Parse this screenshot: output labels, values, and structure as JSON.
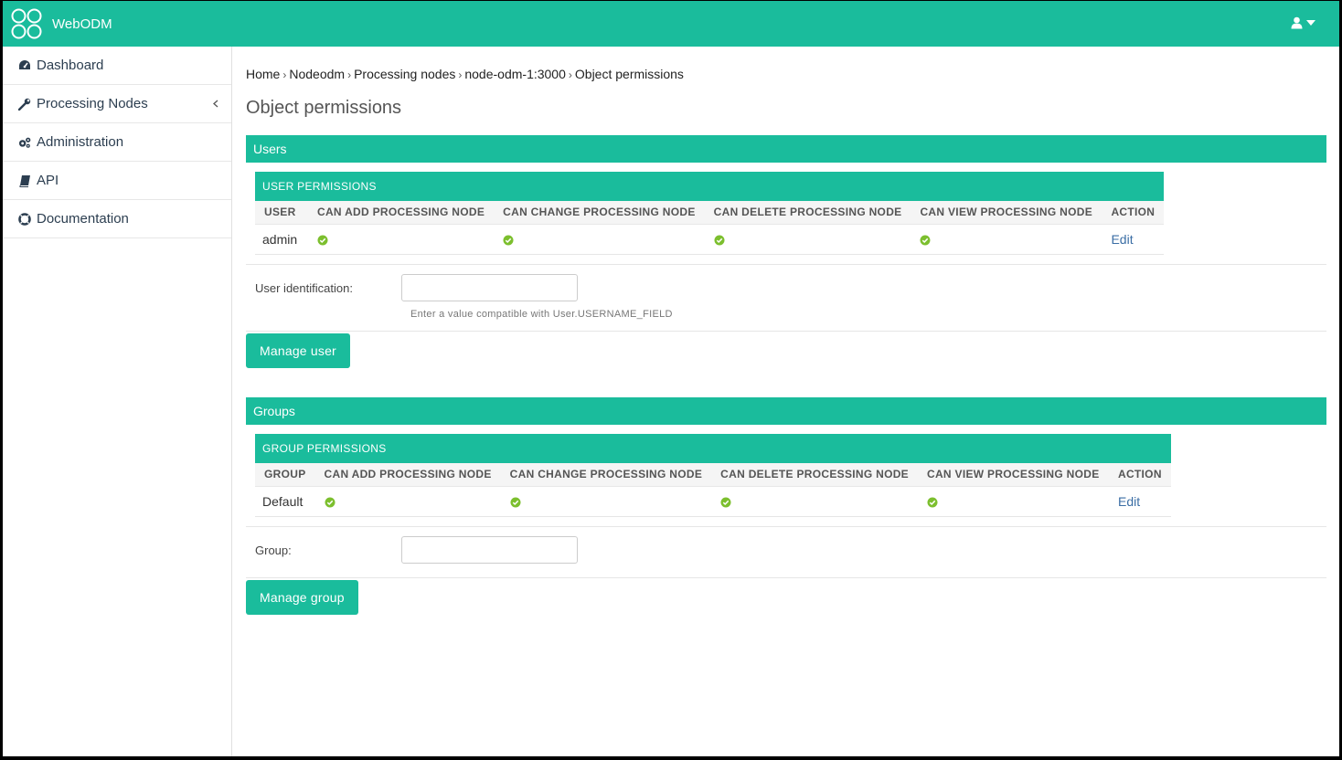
{
  "app": {
    "name": "WebODM"
  },
  "sidebar": {
    "items": [
      {
        "label": "Dashboard",
        "icon": "tachometer-icon"
      },
      {
        "label": "Processing Nodes",
        "icon": "wrench-icon"
      },
      {
        "label": "Administration",
        "icon": "cogs-icon"
      },
      {
        "label": "API",
        "icon": "book-icon"
      },
      {
        "label": "Documentation",
        "icon": "life-ring-icon"
      }
    ]
  },
  "breadcrumb": [
    "Home",
    "Nodeodm",
    "Processing nodes",
    "node-odm-1:3000",
    "Object permissions"
  ],
  "page": {
    "title": "Object permissions"
  },
  "users": {
    "section_title": "Users",
    "table_caption": "USER PERMISSIONS",
    "columns": [
      "USER",
      "CAN ADD PROCESSING NODE",
      "CAN CHANGE PROCESSING NODE",
      "CAN DELETE PROCESSING NODE",
      "CAN VIEW PROCESSING NODE",
      "ACTION"
    ],
    "rows": [
      {
        "name": "admin",
        "action": "Edit"
      }
    ],
    "field_label": "User identification:",
    "field_value": "",
    "help_text": "Enter a value compatible with User.USERNAME_FIELD",
    "button_label": "Manage user"
  },
  "groups": {
    "section_title": "Groups",
    "table_caption": "GROUP PERMISSIONS",
    "columns": [
      "GROUP",
      "CAN ADD PROCESSING NODE",
      "CAN CHANGE PROCESSING NODE",
      "CAN DELETE PROCESSING NODE",
      "CAN VIEW PROCESSING NODE",
      "ACTION"
    ],
    "rows": [
      {
        "name": "Default",
        "action": "Edit"
      }
    ],
    "field_label": "Group:",
    "field_value": "",
    "button_label": "Manage group"
  },
  "colors": {
    "accent": "#1abc9c",
    "check": "#7cbf2e",
    "link": "#3b6ea5"
  }
}
